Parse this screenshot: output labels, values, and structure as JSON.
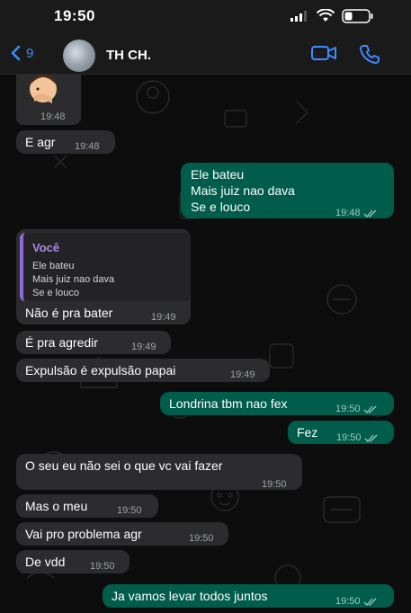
{
  "status_bar": {
    "time": "19:50"
  },
  "header": {
    "back_count": "9",
    "contact_name": "TH CH."
  },
  "messages": [
    {
      "dir": "in",
      "text": "",
      "time": "19:48",
      "note": "emoji"
    },
    {
      "dir": "in",
      "text": "E agr",
      "time": "19:48"
    },
    {
      "dir": "out",
      "lines": [
        "Ele bateu",
        "Mais juiz nao dava",
        "Se e louco"
      ],
      "time": "19:48"
    },
    {
      "dir": "in",
      "quote_author": "Você",
      "quote_lines": [
        "Ele bateu",
        "Mais juiz nao dava",
        "Se e louco"
      ],
      "text": "Não é pra bater",
      "time": "19:49"
    },
    {
      "dir": "in",
      "text": "É pra agredir",
      "time": "19:49"
    },
    {
      "dir": "in",
      "text": "Expulsão é expulsão papai",
      "time": "19:49"
    },
    {
      "dir": "out",
      "text": "Londrina tbm nao fex",
      "time": "19:50"
    },
    {
      "dir": "out",
      "text": "Fez",
      "time": "19:50"
    },
    {
      "dir": "in",
      "text": "O seu eu não sei o que vc vai fazer",
      "time": "19:50"
    },
    {
      "dir": "in",
      "text": "Mas o meu",
      "time": "19:50"
    },
    {
      "dir": "in",
      "text": "Vai pro problema agr",
      "time": "19:50"
    },
    {
      "dir": "in",
      "text": "De vdd",
      "time": "19:50"
    },
    {
      "dir": "out",
      "text": "Ja vamos levar todos juntos",
      "time": "19:50"
    }
  ],
  "icons": [
    "chevron-left-icon",
    "video-camera-icon",
    "phone-icon",
    "signal-icon",
    "wifi-icon",
    "battery-icon",
    "read-receipt-icon"
  ],
  "colors": {
    "incoming": "#2c2c2e",
    "outgoing": "#005c4b",
    "accent": "#3c8cff",
    "quote_bar": "#8e6bd6"
  }
}
